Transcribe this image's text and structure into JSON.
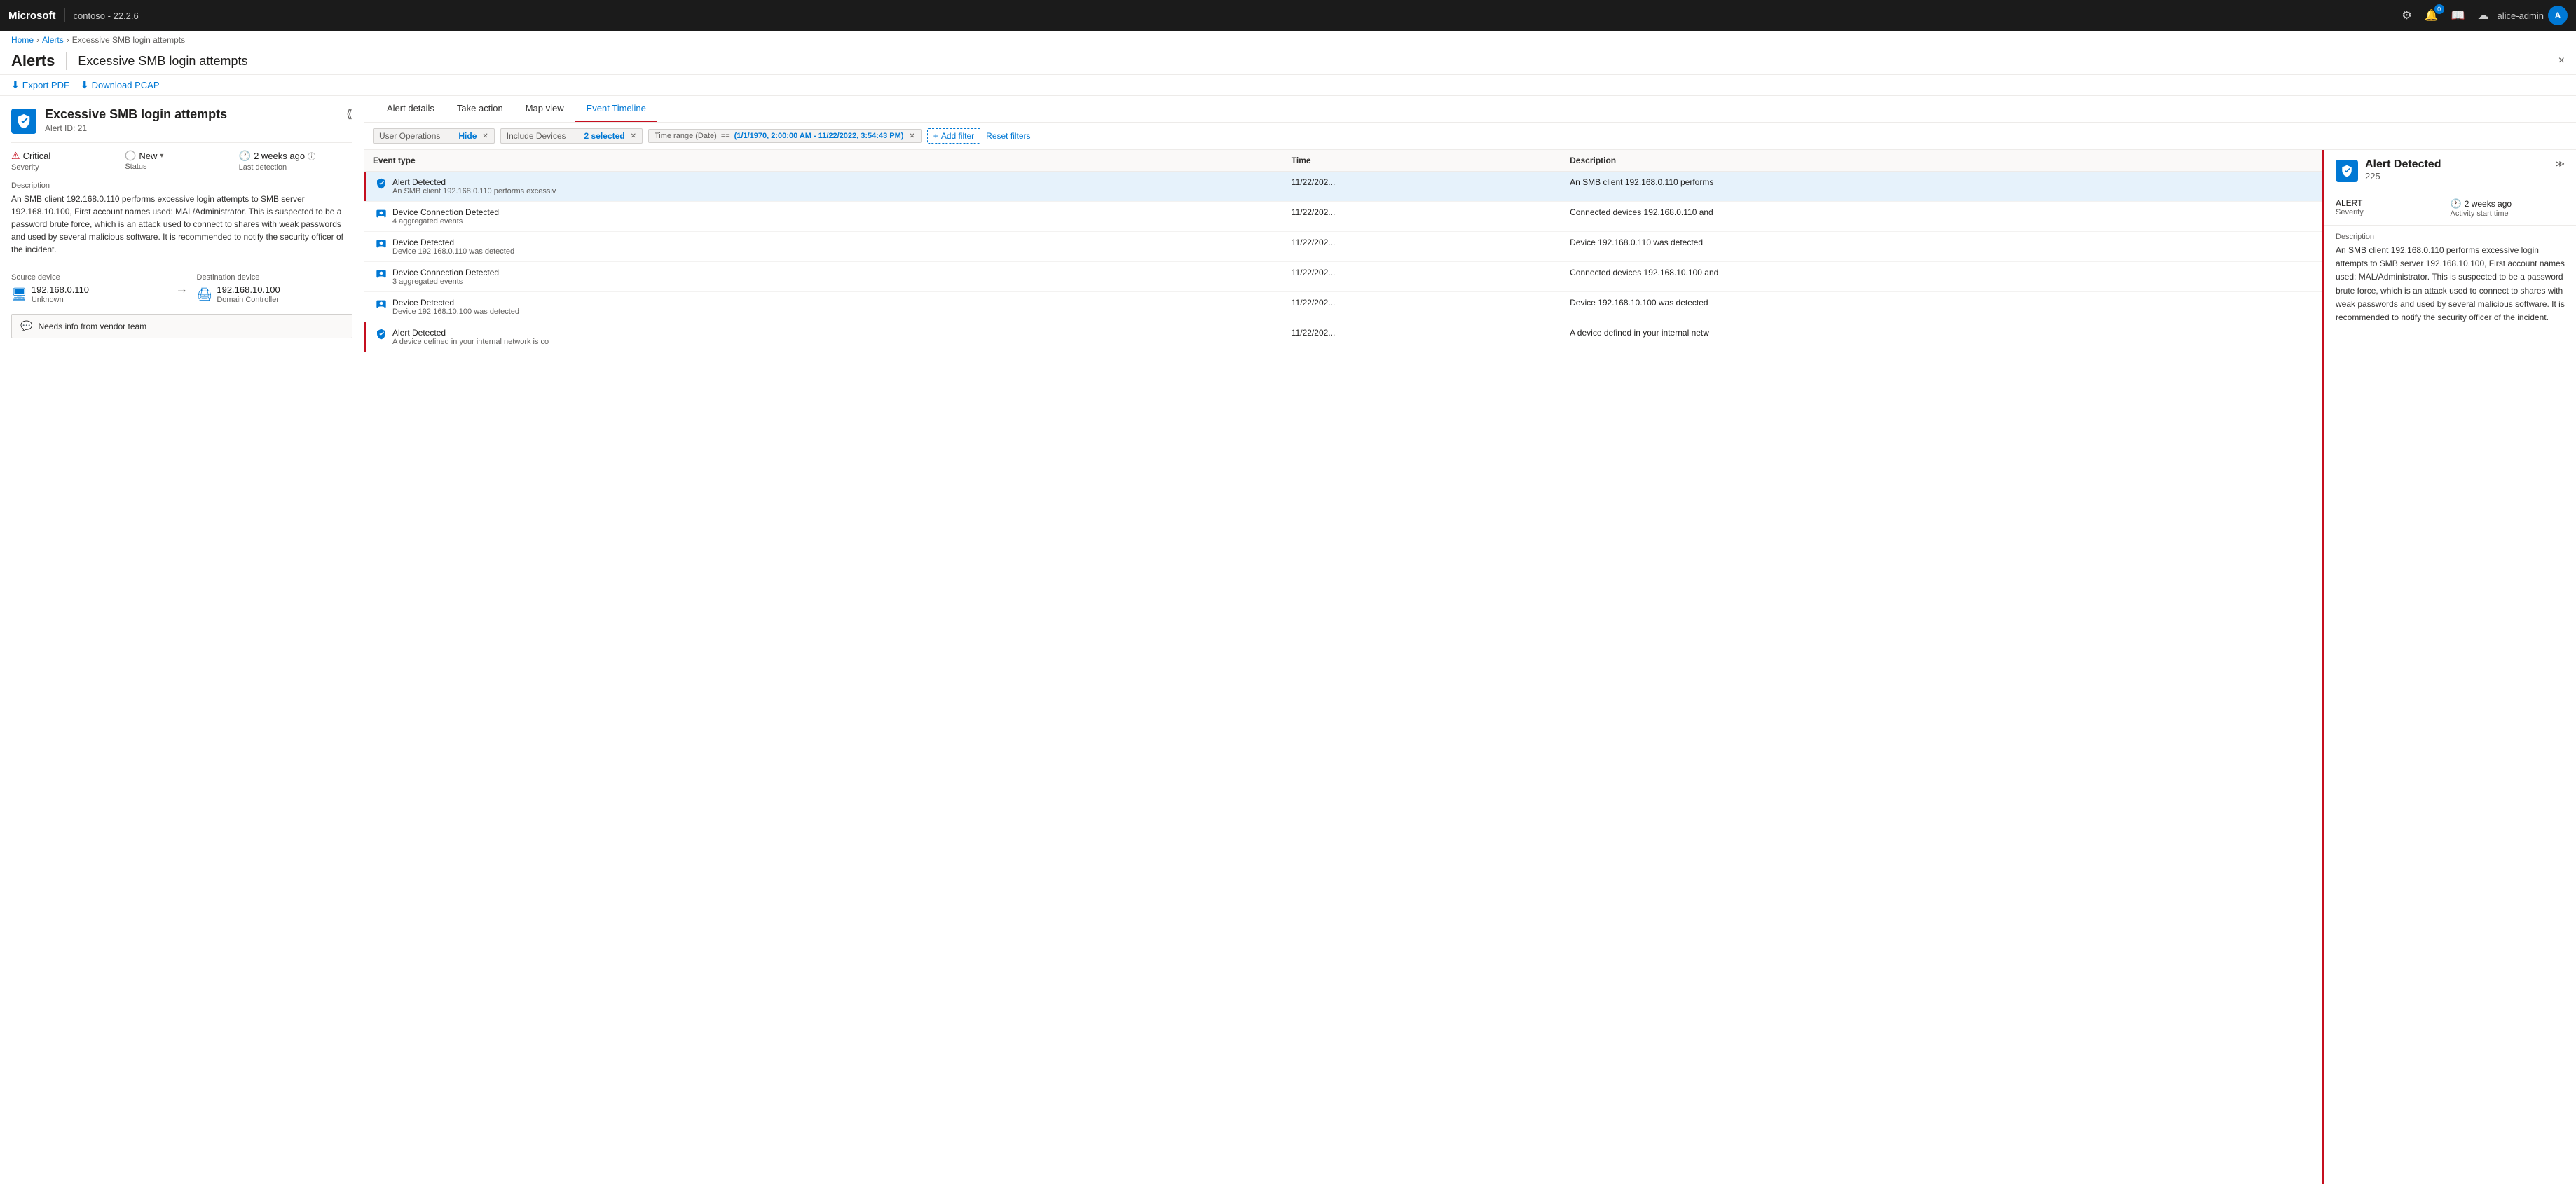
{
  "topbar": {
    "brand": "Microsoft",
    "app": "contoso - 22.2.6",
    "notification_count": "0",
    "username": "alice-admin",
    "avatar_initials": "A"
  },
  "breadcrumb": {
    "home": "Home",
    "alerts": "Alerts",
    "current": "Excessive SMB login attempts"
  },
  "page": {
    "title": "Alerts",
    "subtitle": "Excessive SMB login attempts",
    "close_label": "×"
  },
  "toolbar": {
    "export_pdf": "Export PDF",
    "download_pcap": "Download PCAP"
  },
  "left_panel": {
    "alert_title": "Excessive SMB login attempts",
    "alert_id": "Alert ID: 21",
    "severity_label": "Severity",
    "severity_value": "Critical",
    "status_label": "Status",
    "status_value": "New",
    "last_detection_label": "Last detection",
    "last_detection_value": "2 weeks ago",
    "description_label": "Description",
    "description_text": "An SMB client 192.168.0.110 performs excessive login attempts to SMB server 192.168.10.100, First account names used: MAL/Administrator. This is suspected to be a password brute force, which is an attack used to connect to shares with weak passwords and used by several malicious software. It is recommended to notify the security officer of the incident.",
    "source_device_label": "Source device",
    "source_device_ip": "192.168.0.110",
    "source_device_sub": "Unknown",
    "destination_device_label": "Destination device",
    "destination_device_ip": "192.168.10.100",
    "destination_device_sub": "Domain Controller",
    "comment_text": "Needs info from vendor team"
  },
  "tabs": [
    {
      "id": "alert-details",
      "label": "Alert details",
      "active": false
    },
    {
      "id": "take-action",
      "label": "Take action",
      "active": false
    },
    {
      "id": "map-view",
      "label": "Map view",
      "active": false
    },
    {
      "id": "event-timeline",
      "label": "Event Timeline",
      "active": true
    }
  ],
  "filters": {
    "chips": [
      {
        "key": "User Operations",
        "op": "==",
        "val": "Hide"
      },
      {
        "key": "Include Devices",
        "op": "==",
        "val": "2 selected"
      },
      {
        "key": "Time range (Date)",
        "op": "==",
        "val": "(1/1/1970, 2:00:00 AM - 11/22/2022, 3:54:43 PM)"
      }
    ],
    "add_filter_label": "Add filter",
    "reset_filters_label": "Reset filters"
  },
  "event_table": {
    "columns": [
      "Event type",
      "Time",
      "Description"
    ],
    "rows": [
      {
        "id": 1,
        "icon_type": "alert",
        "name": "Alert Detected",
        "sub": "An SMB client 192.168.0.110 performs excessiv",
        "time": "11/22/202...",
        "description": "An SMB client 192.168.0.110 performs",
        "selected": true,
        "red_bar": true
      },
      {
        "id": 2,
        "icon_type": "device",
        "name": "Device Connection Detected",
        "sub": "4 aggregated events",
        "time": "11/22/202...",
        "description": "Connected devices 192.168.0.110 and",
        "selected": false,
        "red_bar": false
      },
      {
        "id": 3,
        "icon_type": "device",
        "name": "Device Detected",
        "sub": "Device 192.168.0.110 was detected",
        "time": "11/22/202...",
        "description": "Device 192.168.0.110 was detected",
        "selected": false,
        "red_bar": false
      },
      {
        "id": 4,
        "icon_type": "device",
        "name": "Device Connection Detected",
        "sub": "3 aggregated events",
        "time": "11/22/202...",
        "description": "Connected devices 192.168.10.100 and",
        "selected": false,
        "red_bar": false
      },
      {
        "id": 5,
        "icon_type": "device",
        "name": "Device Detected",
        "sub": "Device 192.168.10.100 was detected",
        "time": "11/22/202...",
        "description": "Device 192.168.10.100 was detected",
        "selected": false,
        "red_bar": false
      },
      {
        "id": 6,
        "icon_type": "alert",
        "name": "Alert Detected",
        "sub": "A device defined in your internal network is co",
        "time": "11/22/202...",
        "description": "A device defined in your internal netw",
        "selected": false,
        "red_bar": true
      }
    ]
  },
  "detail_panel": {
    "title": "Alert Detected",
    "count": "225",
    "severity_label": "ALERT",
    "severity_sub_label": "Severity",
    "time_label": "2 weeks ago",
    "time_sub_label": "Activity start time",
    "description_label": "Description",
    "description_text": "An SMB client 192.168.0.110 performs excessive login attempts to SMB server 192.168.10.100, First account names used: MAL/Administrator. This is suspected to be a password brute force, which is an attack used to connect to shares with weak passwords and used by several malicious software. It is recommended to notify the security officer of the incident."
  }
}
